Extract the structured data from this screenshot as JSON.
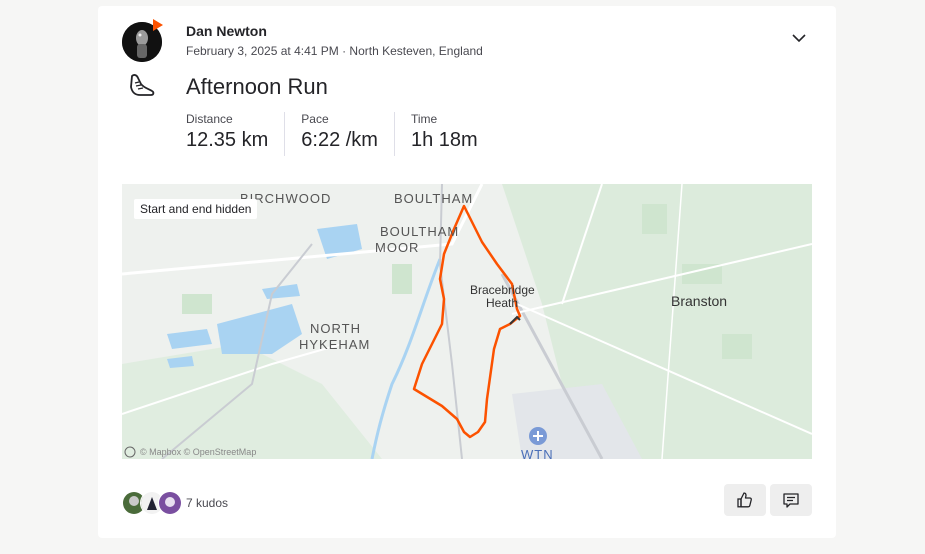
{
  "athlete": {
    "name": "Dan Newton",
    "avatar_icon": "athlete-avatar",
    "badge_color": "#fc5200"
  },
  "activity": {
    "meta": "February 3, 2025 at 4:41 PM · North Kesteven, England",
    "title": "Afternoon Run",
    "type_icon": "running-shoe-icon",
    "stats": [
      {
        "label": "Distance",
        "value": "12.35 km"
      },
      {
        "label": "Pace",
        "value": "6:22 /km"
      },
      {
        "label": "Time",
        "value": "1h 18m"
      }
    ]
  },
  "map": {
    "privacy_label": "Start and end hidden",
    "route_color": "#fc5200",
    "places": [
      "BIRCHWOOD",
      "BOULTHAM",
      "BOULTHAM",
      "MOOR",
      "Bracebridge",
      "Heath",
      "Branston",
      "NORTH",
      "HYKEHAM",
      "WTN"
    ],
    "attribution": "© Mapbox © OpenStreetMap"
  },
  "kudos": {
    "text": "7 kudos"
  },
  "actions": {
    "kudos_icon": "thumbs-up-icon",
    "comment_icon": "comment-icon"
  }
}
